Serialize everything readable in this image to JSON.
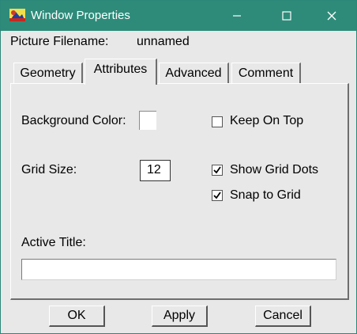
{
  "window": {
    "title": "Window Properties",
    "titlebar_color": "#2e8b7a",
    "icons": [
      "app-icon",
      "minimize-icon",
      "maximize-icon",
      "close-icon"
    ]
  },
  "header": {
    "filename_label": "Picture Filename:",
    "filename_value": "unnamed"
  },
  "tabs": [
    {
      "label": "Geometry",
      "selected": false
    },
    {
      "label": "Attributes",
      "selected": true
    },
    {
      "label": "Advanced",
      "selected": false
    },
    {
      "label": "Comment",
      "selected": false
    }
  ],
  "attributes": {
    "background_color_label": "Background Color:",
    "background_color_value": "#ffffff",
    "grid_size_label": "Grid Size:",
    "grid_size_value": "12",
    "keep_on_top": {
      "label": "Keep On Top",
      "checked": false
    },
    "show_grid_dots": {
      "label": "Show Grid Dots",
      "checked": true
    },
    "snap_to_grid": {
      "label": "Snap to Grid",
      "checked": true
    },
    "active_title_label": "Active Title:",
    "active_title_value": ""
  },
  "buttons": {
    "ok": "OK",
    "apply": "Apply",
    "cancel": "Cancel"
  }
}
